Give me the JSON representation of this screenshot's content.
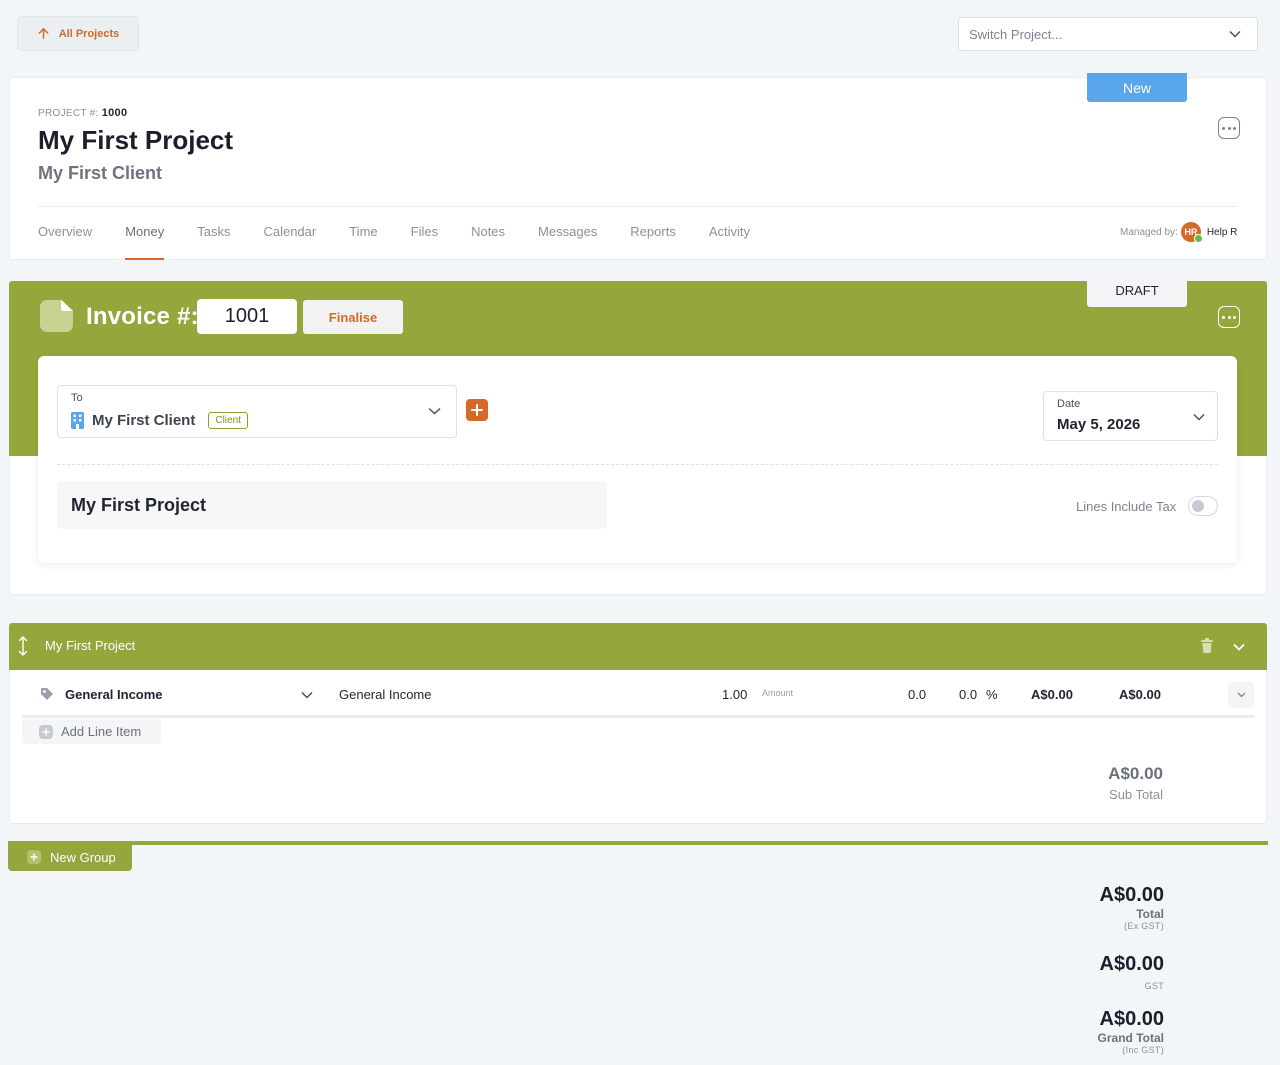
{
  "topbar": {
    "all_projects_label": "All Projects",
    "switch_project_placeholder": "Switch Project..."
  },
  "project": {
    "status_tag": "New",
    "number_label": "PROJECT #:",
    "number": "1000",
    "title": "My First Project",
    "client": "My First Client",
    "managed_by_label": "Managed by:",
    "manager_initials": "HR",
    "manager_name": "Help R"
  },
  "tabs": [
    {
      "label": "Overview"
    },
    {
      "label": "Money"
    },
    {
      "label": "Tasks"
    },
    {
      "label": "Calendar"
    },
    {
      "label": "Time"
    },
    {
      "label": "Files"
    },
    {
      "label": "Notes"
    },
    {
      "label": "Messages"
    },
    {
      "label": "Reports"
    },
    {
      "label": "Activity"
    }
  ],
  "active_tab": "Money",
  "invoice": {
    "status_tag": "DRAFT",
    "label": "Invoice #:",
    "number": "1001",
    "finalise_label": "Finalise",
    "to_label": "To",
    "to_value": "My First Client",
    "to_badge": "Client",
    "date_label": "Date",
    "date_value": "May 5, 2026",
    "group_name": "My First Project",
    "lines_include_tax_label": "Lines Include Tax",
    "lines_include_tax": false
  },
  "group": {
    "title": "My First Project",
    "line_items": [
      {
        "account": "General Income",
        "description": "General Income",
        "quantity": "1.00",
        "rate_label": "Amount",
        "discount": "0.0",
        "tax": "0.0",
        "tax_unit": "%",
        "unit_price": "A$0.00",
        "total": "A$0.00"
      }
    ],
    "add_line_label": "Add Line Item",
    "subtotal_value": "A$0.00",
    "subtotal_label": "Sub Total"
  },
  "new_group_label": "New Group",
  "totals": {
    "total_value": "A$0.00",
    "total_label": "Total",
    "total_sub": "(Ex GST)",
    "gst_value": "A$0.00",
    "gst_sub": "GST",
    "grand_value": "A$0.00",
    "grand_label": "Grand Total",
    "grand_sub": "(Inc GST)"
  },
  "colors": {
    "accent": "#d3692a",
    "invoice_green": "#94a63c",
    "new_blue": "#5aa6ea"
  },
  "icons": [
    "arrow-up-icon",
    "chevron-down-icon",
    "more-icon",
    "document-icon",
    "building-icon",
    "plus-icon",
    "reorder-icon",
    "trash-icon",
    "tag-icon"
  ]
}
